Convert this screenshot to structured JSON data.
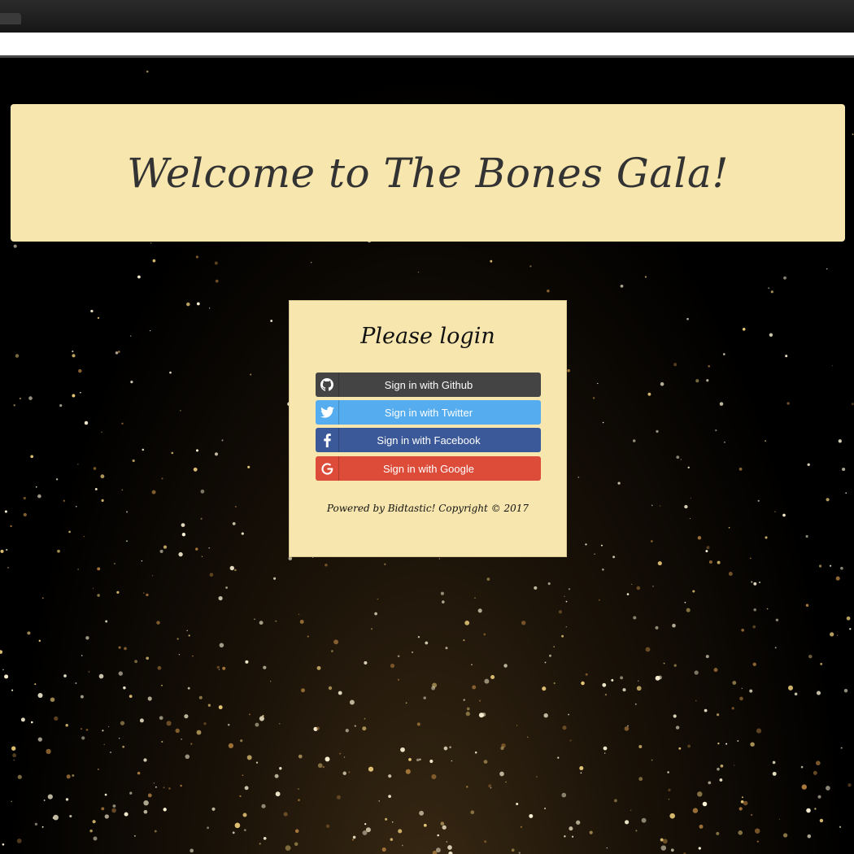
{
  "header": {
    "title": "Welcome to The Bones Gala!"
  },
  "login": {
    "heading": "Please login",
    "buttons": [
      {
        "label": "Sign in with Github",
        "icon": "github-icon",
        "color": "#444444"
      },
      {
        "label": "Sign in with Twitter",
        "icon": "twitter-icon",
        "color": "#55acee"
      },
      {
        "label": "Sign in with Facebook",
        "icon": "facebook-icon",
        "color": "#3b5998"
      },
      {
        "label": "Sign in with Google",
        "icon": "google-icon",
        "color": "#dd4b39"
      }
    ],
    "footer": "Powered by Bidtastic! Copyright © 2017"
  },
  "colors": {
    "panel_background": "#f7e6ad",
    "page_background": "#000000"
  }
}
